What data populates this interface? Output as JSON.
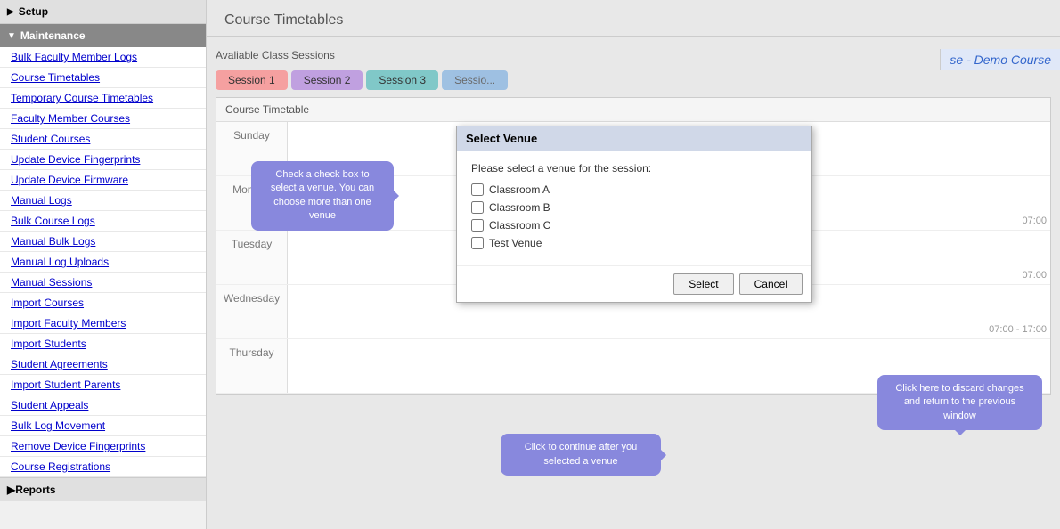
{
  "sidebar": {
    "setup_label": "Setup",
    "maintenance_label": "Maintenance",
    "reports_label": "Reports",
    "items": [
      {
        "label": "Bulk Faculty Member Logs",
        "id": "bulk-faculty-logs"
      },
      {
        "label": "Course Timetables",
        "id": "course-timetables"
      },
      {
        "label": "Temporary Course Timetables",
        "id": "temp-course-timetables"
      },
      {
        "label": "Faculty Member Courses",
        "id": "faculty-member-courses"
      },
      {
        "label": "Student Courses",
        "id": "student-courses"
      },
      {
        "label": "Update Device Fingerprints",
        "id": "update-device-fingerprints"
      },
      {
        "label": "Update Device Firmware",
        "id": "update-device-firmware"
      },
      {
        "label": "Manual Logs",
        "id": "manual-logs"
      },
      {
        "label": "Bulk Course Logs",
        "id": "bulk-course-logs"
      },
      {
        "label": "Manual Bulk Logs",
        "id": "manual-bulk-logs"
      },
      {
        "label": "Manual Log Uploads",
        "id": "manual-log-uploads"
      },
      {
        "label": "Manual Sessions",
        "id": "manual-sessions"
      },
      {
        "label": "Import Courses",
        "id": "import-courses"
      },
      {
        "label": "Import Faculty Members",
        "id": "import-faculty-members"
      },
      {
        "label": "Import Students",
        "id": "import-students"
      },
      {
        "label": "Student Agreements",
        "id": "student-agreements"
      },
      {
        "label": "Import Student Parents",
        "id": "import-student-parents"
      },
      {
        "label": "Student Appeals",
        "id": "student-appeals"
      },
      {
        "label": "Bulk Log Movement",
        "id": "bulk-log-movement"
      },
      {
        "label": "Remove Device Fingerprints",
        "id": "remove-device-fingerprints"
      },
      {
        "label": "Course Registrations",
        "id": "course-registrations"
      }
    ]
  },
  "page": {
    "title": "Course Timetables",
    "demo_course": "se - Demo Course"
  },
  "sessions": {
    "header": "Avaliable Class Sessions",
    "tabs": [
      {
        "label": "Session 1",
        "style": "pink"
      },
      {
        "label": "Session 2",
        "style": "purple"
      },
      {
        "label": "Session 3",
        "style": "teal"
      },
      {
        "label": "Sessio...",
        "style": "blue"
      }
    ]
  },
  "timetable": {
    "header": "Course Timetable",
    "days": [
      {
        "label": "Sunday",
        "time": ""
      },
      {
        "label": "Monday",
        "time": "07:00"
      },
      {
        "label": "Tuesday",
        "time": "07:00"
      },
      {
        "label": "Wednesday",
        "time": "07:00 - 17:00"
      },
      {
        "label": "Thursday",
        "time": ""
      }
    ]
  },
  "dialog": {
    "title": "Select Venue",
    "instruction": "Please select a venue for the session:",
    "venues": [
      {
        "label": "Classroom A"
      },
      {
        "label": "Classroom B"
      },
      {
        "label": "Classroom C"
      },
      {
        "label": "Test Venue"
      }
    ],
    "select_btn": "Select",
    "cancel_btn": "Cancel"
  },
  "tooltips": {
    "select_venue": "Check a check box to select a venue. You can choose more than one venue",
    "continue": "Click to continue after you selected a venue",
    "discard": "Click here to discard changes and return to the previous window"
  }
}
